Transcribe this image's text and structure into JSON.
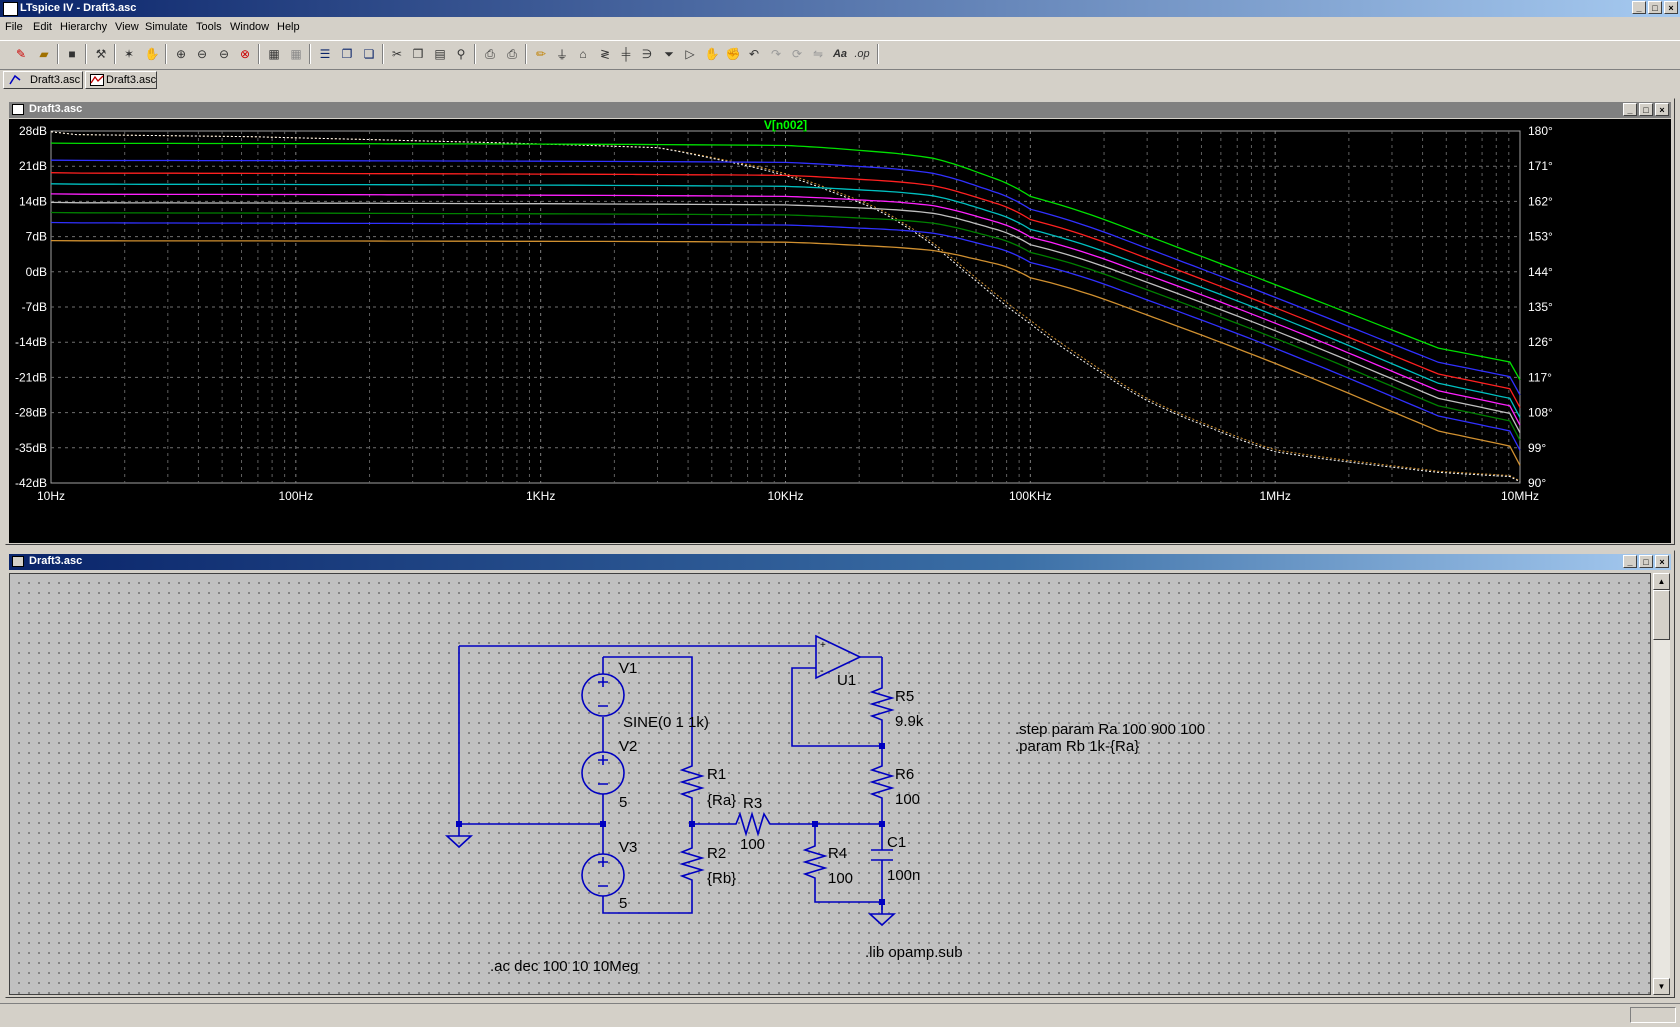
{
  "window": {
    "title": "LTspice IV - Draft3.asc"
  },
  "menu": [
    "File",
    "Edit",
    "Hierarchy",
    "View",
    "Simulate",
    "Tools",
    "Window",
    "Help"
  ],
  "toolbar": {
    "icons": [
      "new-schematic-icon",
      "open-icon",
      "save-icon",
      "control-panel-icon",
      "run-icon",
      "halt-icon",
      "zoom-in-icon",
      "zoom-out-icon",
      "zoom-out-icon",
      "zoom-cancel-icon",
      "autorange-icon",
      "grid-icon",
      "tile-horizontal-icon",
      "cascade-icon",
      "close-all-icon",
      "cut-icon",
      "copy-icon",
      "paste-icon",
      "find-icon",
      "print-setup-icon",
      "print-icon",
      "wire-icon",
      "ground-icon",
      "label-net-icon",
      "resistor-icon",
      "capacitor-icon",
      "inductor-icon",
      "diode-icon",
      "component-icon",
      "move-icon",
      "drag-icon",
      "undo-icon",
      "redo-icon",
      "rotate-icon",
      "mirror-icon",
      "text-icon",
      "spice-directive-icon"
    ],
    "text_aa": "Aa",
    "text_op": ".op"
  },
  "tabs": [
    {
      "label": "Draft3.asc",
      "icon": "schematic-icon"
    },
    {
      "label": "Draft3.asc",
      "icon": "waveform-icon"
    }
  ],
  "plot_window": {
    "title": "Draft3.asc"
  },
  "schematic_window": {
    "title": "Draft3.asc"
  },
  "chart_data": {
    "type": "line",
    "title": "V[n002]",
    "x_scale": "log",
    "xlim": [
      10,
      10000000
    ],
    "x_ticks": [
      "10Hz",
      "100Hz",
      "1KHz",
      "10KHz",
      "100KHz",
      "1MHz",
      "10MHz"
    ],
    "ylim": [
      -42,
      28
    ],
    "y_ticks_left": [
      "28dB",
      "21dB",
      "14dB",
      "7dB",
      "0dB",
      "-7dB",
      "-14dB",
      "-21dB",
      "-28dB",
      "-35dB",
      "-42dB"
    ],
    "y2lim": [
      90,
      180
    ],
    "y_ticks_right": [
      "180°",
      "171°",
      "162°",
      "153°",
      "144°",
      "135°",
      "126°",
      "117°",
      "108°",
      "99°",
      "90°"
    ],
    "grid": true,
    "magnitude_series": [
      {
        "color": "#00e000",
        "x": [
          10,
          10000,
          40000,
          100000,
          1000000,
          10000000
        ],
        "y": [
          25.6,
          25.3,
          23,
          16,
          -2.5,
          -21.5
        ]
      },
      {
        "color": "#3030ff",
        "x": [
          10,
          10000,
          40000,
          100000,
          1000000,
          10000000
        ],
        "y": [
          22.2,
          21.9,
          20,
          13.5,
          -5,
          -24.5
        ]
      },
      {
        "color": "#ff2020",
        "x": [
          10,
          10000,
          40000,
          100000,
          1000000,
          10000000
        ],
        "y": [
          19.7,
          19.3,
          17.5,
          11.5,
          -7,
          -27
        ]
      },
      {
        "color": "#00c0c0",
        "x": [
          10,
          10000,
          40000,
          100000,
          1000000,
          10000000
        ],
        "y": [
          17.5,
          17.1,
          15.5,
          9.5,
          -8.5,
          -29
        ]
      },
      {
        "color": "#ff20ff",
        "x": [
          10,
          10000,
          40000,
          100000,
          1000000,
          10000000
        ],
        "y": [
          15.5,
          15.1,
          13.5,
          8,
          -10,
          -30.5
        ]
      },
      {
        "color": "#c0c0c0",
        "x": [
          10,
          10000,
          40000,
          100000,
          1000000,
          10000000
        ],
        "y": [
          13.8,
          13.4,
          12,
          6.5,
          -11.5,
          -32
        ]
      },
      {
        "color": "#008000",
        "x": [
          10,
          10000,
          40000,
          100000,
          1000000,
          10000000
        ],
        "y": [
          11.8,
          11.4,
          10,
          5,
          -13,
          -33.5
        ]
      },
      {
        "color": "#3030ff",
        "x": [
          10,
          10000,
          40000,
          100000,
          1000000,
          10000000
        ],
        "y": [
          9.8,
          9.4,
          8,
          3,
          -15,
          -35.5
        ]
      },
      {
        "color": "#d09030",
        "x": [
          10,
          10000,
          40000,
          100000,
          1000000,
          10000000
        ],
        "y": [
          6.2,
          6,
          4.5,
          0,
          -18,
          -38.5
        ]
      }
    ],
    "phase_series": [
      {
        "color": "#d09030",
        "x": [
          10,
          3000,
          10000,
          30000,
          100000,
          300000,
          1000000,
          10000000
        ],
        "y": [
          179.8,
          176,
          169.5,
          158,
          131,
          111,
          98,
          90.5
        ]
      },
      {
        "color": "#ffffff",
        "x": [
          10,
          3000,
          10000,
          30000,
          100000,
          300000,
          1000000,
          10000000
        ],
        "y": [
          179.8,
          176,
          169,
          157.5,
          130,
          110.5,
          97.5,
          90.3
        ]
      }
    ]
  },
  "schematic": {
    "components": [
      {
        "ref": "V1",
        "value": "SINE(0 1 1k)"
      },
      {
        "ref": "V2",
        "value": "5"
      },
      {
        "ref": "V3",
        "value": "5"
      },
      {
        "ref": "R1",
        "value": "{Ra}"
      },
      {
        "ref": "R2",
        "value": "{Rb}"
      },
      {
        "ref": "R3",
        "value": "100"
      },
      {
        "ref": "R4",
        "value": "100"
      },
      {
        "ref": "R5",
        "value": "9.9k"
      },
      {
        "ref": "R6",
        "value": "100"
      },
      {
        "ref": "C1",
        "value": "100n"
      },
      {
        "ref": "U1",
        "value": ""
      }
    ],
    "directives": {
      "step": ".step param Ra 100 900 100",
      "param": ".param Rb 1k-{Ra}",
      "ac": ".ac dec 100 10 10Meg",
      "lib": ".lib opamp.sub"
    },
    "opamp_plus": "+",
    "opamp_minus": "-"
  }
}
